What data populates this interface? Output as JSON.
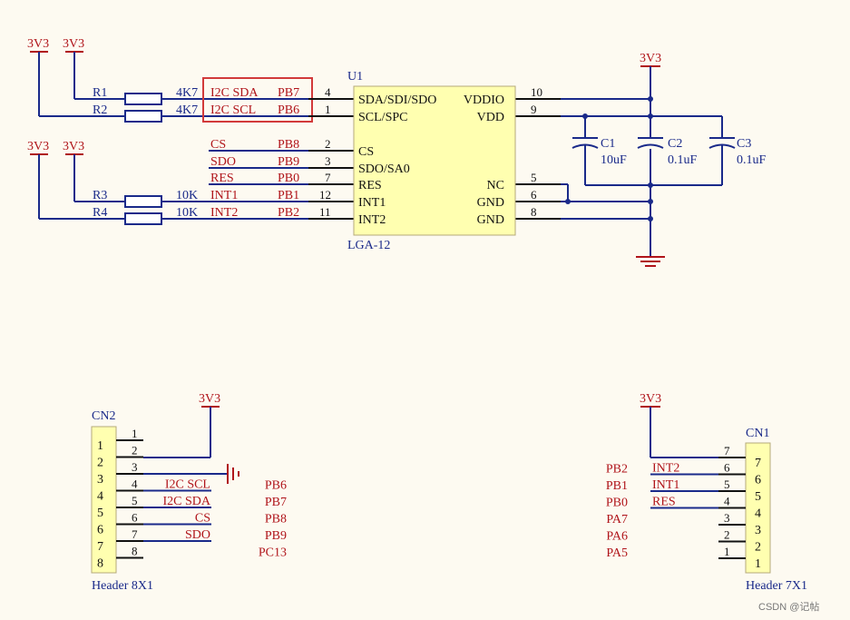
{
  "u1": {
    "ref": "U1",
    "package": "LGA-12",
    "left_pins": [
      {
        "num": "4",
        "name": "SDA/SDI/SDO"
      },
      {
        "num": "1",
        "name": "SCL/SPC"
      },
      {
        "num": "2",
        "name": "CS"
      },
      {
        "num": "3",
        "name": "SDO/SA0"
      },
      {
        "num": "7",
        "name": "RES"
      },
      {
        "num": "12",
        "name": "INT1"
      },
      {
        "num": "11",
        "name": "INT2"
      }
    ],
    "right_pins": [
      {
        "num": "10",
        "name": "VDDIO"
      },
      {
        "num": "9",
        "name": "VDD"
      },
      {
        "num": "5",
        "name": "NC"
      },
      {
        "num": "6",
        "name": "GND"
      },
      {
        "num": "8",
        "name": "GND"
      }
    ]
  },
  "power_label": "3V3",
  "resistors": [
    {
      "ref": "R1",
      "value": "4K7"
    },
    {
      "ref": "R2",
      "value": "4K7"
    },
    {
      "ref": "R3",
      "value": "10K"
    },
    {
      "ref": "R4",
      "value": "10K"
    }
  ],
  "nets": [
    {
      "net": "I2C  SDA",
      "mcu": "PB7"
    },
    {
      "net": "I2C  SCL",
      "mcu": "PB6"
    },
    {
      "net": "CS",
      "mcu": "PB8"
    },
    {
      "net": "SDO",
      "mcu": "PB9"
    },
    {
      "net": "RES",
      "mcu": "PB0"
    },
    {
      "net": "INT1",
      "mcu": "PB1"
    },
    {
      "net": "INT2",
      "mcu": "PB2"
    }
  ],
  "capacitors": [
    {
      "ref": "C1",
      "value": "10uF"
    },
    {
      "ref": "C2",
      "value": "0.1uF"
    },
    {
      "ref": "C3",
      "value": "0.1uF"
    }
  ],
  "cn2": {
    "ref": "CN2",
    "type": "Header 8X1",
    "pins": [
      "1",
      "2",
      "3",
      "4",
      "5",
      "6",
      "7",
      "8"
    ],
    "nets": [
      "",
      "",
      "",
      "I2C  SCL",
      "I2C  SDA",
      "CS",
      "SDO",
      ""
    ],
    "mcu": [
      "",
      "",
      "",
      "PB6",
      "PB7",
      "PB8",
      "PB9",
      "PC13"
    ]
  },
  "cn1": {
    "ref": "CN1",
    "type": "Header 7X1",
    "pins": [
      "7",
      "6",
      "5",
      "4",
      "3",
      "2",
      "1"
    ],
    "nets": [
      "",
      "INT2",
      "INT1",
      "RES",
      "",
      "",
      ""
    ],
    "mcu": [
      "",
      "PB2",
      "PB1",
      "PB0",
      "PA7",
      "PA6",
      "PA5"
    ]
  },
  "watermark": "CSDN @记帖"
}
